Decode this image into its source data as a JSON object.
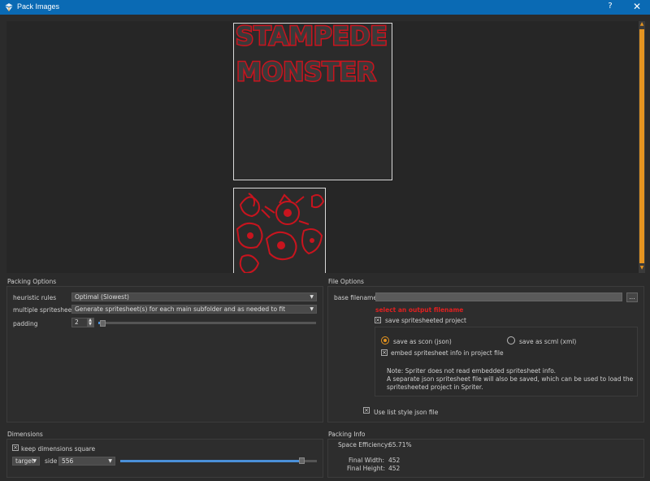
{
  "window": {
    "title": "Pack Images",
    "help_label": "?",
    "close_label": "✕"
  },
  "preview": {
    "sheet1_text_line1": "STAMPEDE",
    "sheet1_text_line2": "MONSTER"
  },
  "packing_options": {
    "title": "Packing Options",
    "heuristic_label": "heuristic rules",
    "heuristic_value": "Optimal (Slowest)",
    "multiple_label": "multiple spritesheets",
    "multiple_value": "Generate spritesheet(s) for each main subfolder and as needed to fit",
    "padding_label": "padding",
    "padding_value": "2",
    "padding_slider_fraction": 0.02
  },
  "file_options": {
    "title": "File Options",
    "base_filename_label": "base filename",
    "base_filename_value": "",
    "browse_label": "...",
    "error_text": "select an output filename",
    "save_spritesheeted_label": "save spritesheeted project",
    "save_scon_label": "save as scon (json)",
    "save_scml_label": "save as scml (xml)",
    "embed_label": "embed spritesheet info in project file",
    "note_line1": "Note: Spriter does not read embedded spritesheet info.",
    "note_line2": "A separate json spritesheet file will also be saved, which can be used to load the",
    "note_line3": "spritesheeted project in Spriter.",
    "list_style_label": "Use list style json file"
  },
  "dimensions": {
    "title": "Dimensions",
    "keep_square_label": "keep dimensions square",
    "target_value": "target",
    "side_label": "side",
    "side_value": "556",
    "side_slider_fraction": 0.92
  },
  "packing_info": {
    "title": "Packing Info",
    "efficiency_label": "Space Efficiency:",
    "efficiency_value": "65.71%",
    "width_label": "Final Width:",
    "width_value": "452",
    "height_label": "Final Height:",
    "height_value": "452"
  },
  "colors": {
    "accent": "#e59420",
    "titlebar": "#0a6ab4",
    "error": "#e02020",
    "sprite_red": "#c8141e"
  },
  "icons": [
    "app-icon",
    "close-icon",
    "help-icon",
    "dropdown-arrow-icon",
    "spin-arrows-icon",
    "checkbox-checked-icon"
  ]
}
